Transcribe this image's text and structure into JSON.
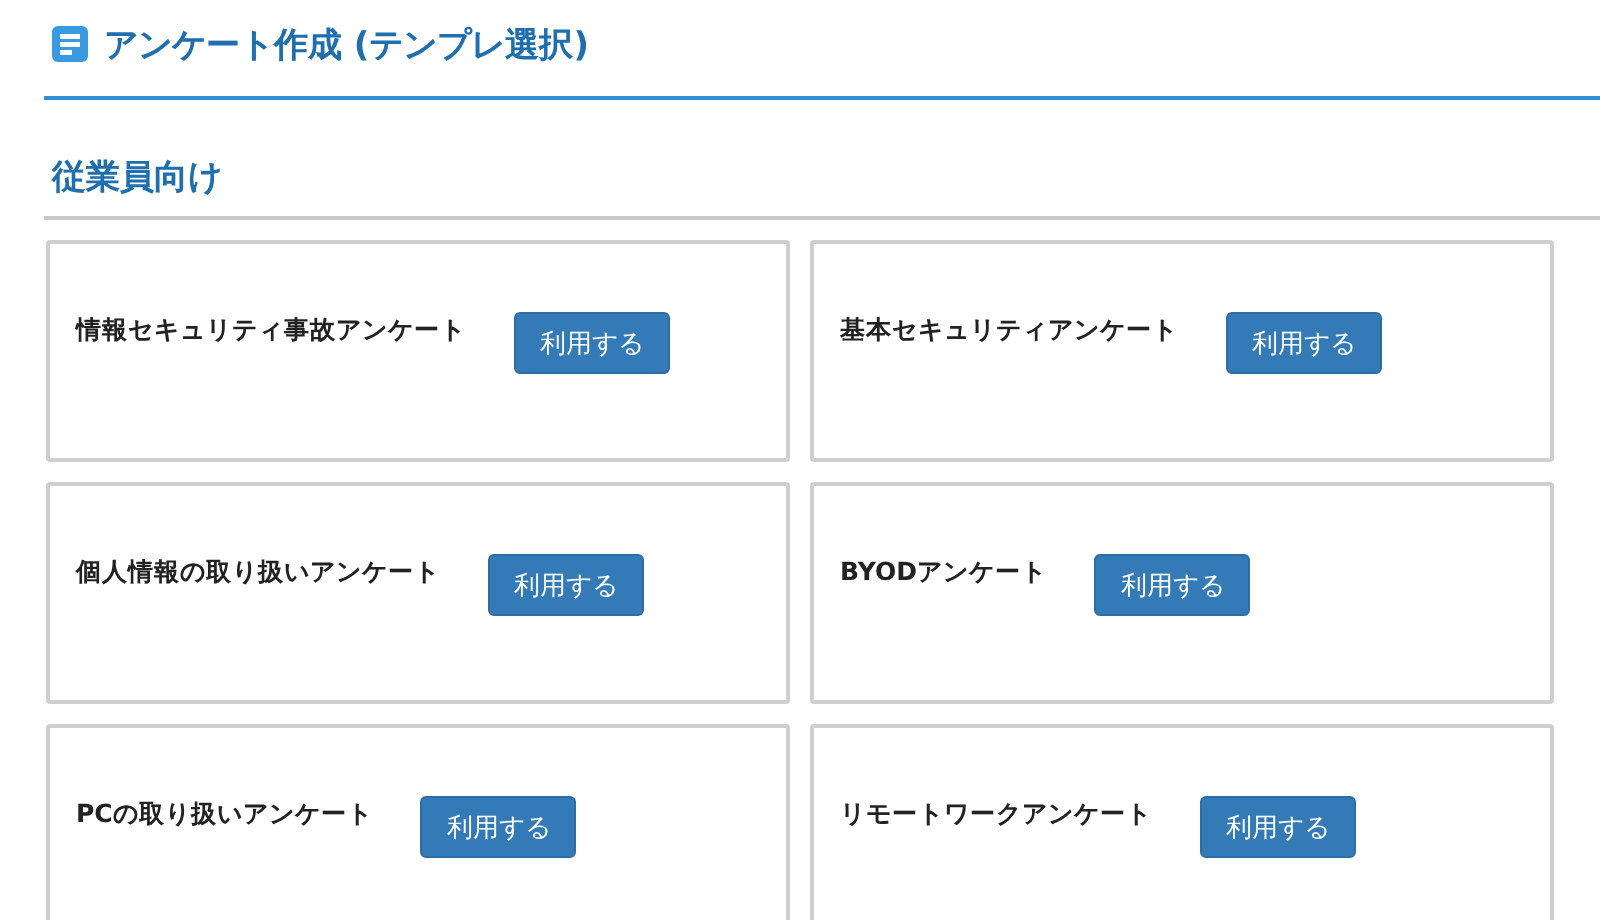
{
  "page": {
    "title": "アンケート作成 (テンプレ選択)"
  },
  "section": {
    "title": "従業員向け"
  },
  "templates": [
    {
      "name": "情報セキュリティ事故アンケート",
      "button": "利用する"
    },
    {
      "name": "基本セキュリティアンケート",
      "button": "利用する"
    },
    {
      "name": "個人情報の取り扱いアンケート",
      "button": "利用する"
    },
    {
      "name": "BYODアンケート",
      "button": "利用する"
    },
    {
      "name": "PCの取り扱いアンケート",
      "button": "利用する"
    },
    {
      "name": "リモートワークアンケート",
      "button": "利用する"
    }
  ]
}
